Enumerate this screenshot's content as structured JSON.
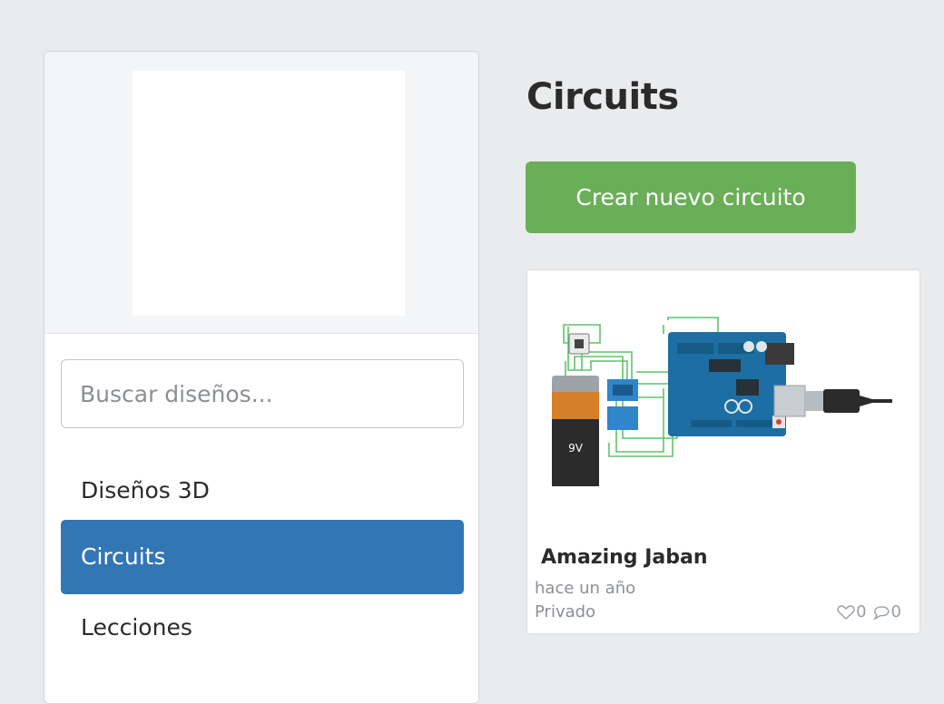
{
  "sidebar": {
    "search": {
      "placeholder": "Buscar diseños..."
    },
    "items": [
      {
        "label": "Diseños 3D",
        "active": false
      },
      {
        "label": "Circuits",
        "active": true
      },
      {
        "label": "Lecciones",
        "active": false
      }
    ]
  },
  "main": {
    "title": "Circuits",
    "create_button_label": "Crear nuevo circuito",
    "designs": [
      {
        "title": "Amazing Jaban",
        "time": "hace un año",
        "privacy": "Privado",
        "likes": "0",
        "comments": "0",
        "thumbnail": {
          "battery_label": "9V"
        }
      }
    ]
  },
  "colors": {
    "accent_blue": "#3276b6",
    "button_green": "#6aaf57",
    "page_bg": "#eaebed",
    "wire_green": "#5ec46b",
    "arduino_blue": "#1d6fa3",
    "battery_orange": "#d67e2a"
  }
}
